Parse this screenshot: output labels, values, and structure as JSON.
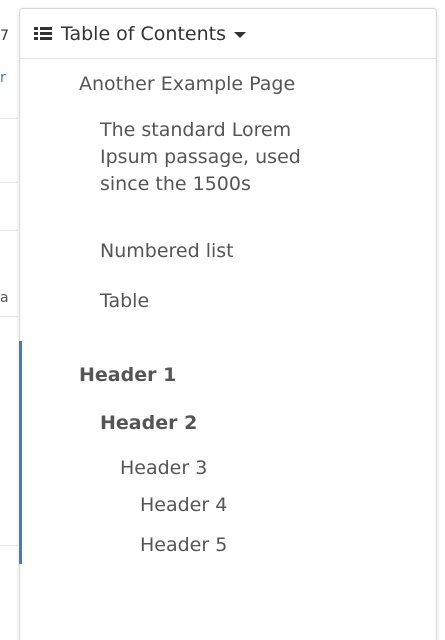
{
  "toc": {
    "title": "Table of Contents",
    "icon": "list-icon",
    "caret": "caret-down-icon",
    "accent_color": "#3a7fc1",
    "items": [
      {
        "label": "Another Example Page"
      },
      {
        "label": "The standard Lorem Ipsum passage, used since the 1500s"
      },
      {
        "label": "Numbered list"
      },
      {
        "label": "Table"
      },
      {
        "label": "Header 1"
      },
      {
        "label": "Header 2"
      },
      {
        "label": "Header 3"
      },
      {
        "label": "Header 4"
      },
      {
        "label": "Header 5"
      }
    ]
  },
  "background": {
    "edge_chars": [
      "7",
      "r",
      "a"
    ]
  }
}
